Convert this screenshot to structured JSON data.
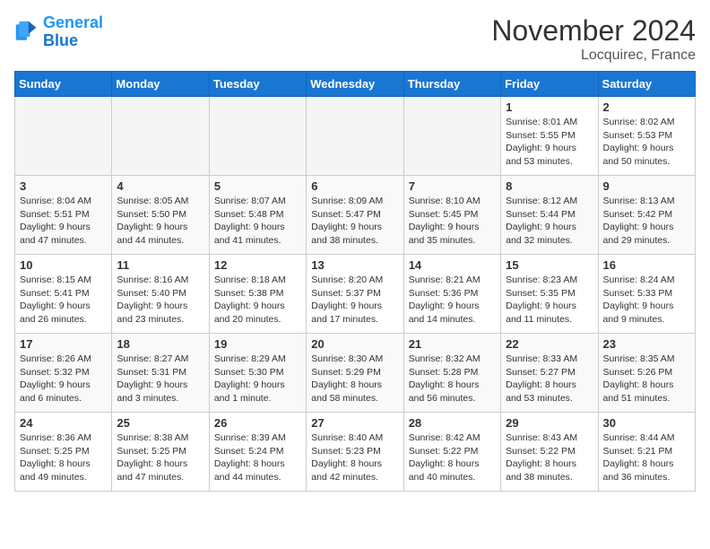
{
  "logo": {
    "line1": "General",
    "line2": "Blue"
  },
  "title": "November 2024",
  "location": "Locquirec, France",
  "weekdays": [
    "Sunday",
    "Monday",
    "Tuesday",
    "Wednesday",
    "Thursday",
    "Friday",
    "Saturday"
  ],
  "weeks": [
    [
      {
        "day": "",
        "info": ""
      },
      {
        "day": "",
        "info": ""
      },
      {
        "day": "",
        "info": ""
      },
      {
        "day": "",
        "info": ""
      },
      {
        "day": "",
        "info": ""
      },
      {
        "day": "1",
        "info": "Sunrise: 8:01 AM\nSunset: 5:55 PM\nDaylight: 9 hours and 53 minutes."
      },
      {
        "day": "2",
        "info": "Sunrise: 8:02 AM\nSunset: 5:53 PM\nDaylight: 9 hours and 50 minutes."
      }
    ],
    [
      {
        "day": "3",
        "info": "Sunrise: 8:04 AM\nSunset: 5:51 PM\nDaylight: 9 hours and 47 minutes."
      },
      {
        "day": "4",
        "info": "Sunrise: 8:05 AM\nSunset: 5:50 PM\nDaylight: 9 hours and 44 minutes."
      },
      {
        "day": "5",
        "info": "Sunrise: 8:07 AM\nSunset: 5:48 PM\nDaylight: 9 hours and 41 minutes."
      },
      {
        "day": "6",
        "info": "Sunrise: 8:09 AM\nSunset: 5:47 PM\nDaylight: 9 hours and 38 minutes."
      },
      {
        "day": "7",
        "info": "Sunrise: 8:10 AM\nSunset: 5:45 PM\nDaylight: 9 hours and 35 minutes."
      },
      {
        "day": "8",
        "info": "Sunrise: 8:12 AM\nSunset: 5:44 PM\nDaylight: 9 hours and 32 minutes."
      },
      {
        "day": "9",
        "info": "Sunrise: 8:13 AM\nSunset: 5:42 PM\nDaylight: 9 hours and 29 minutes."
      }
    ],
    [
      {
        "day": "10",
        "info": "Sunrise: 8:15 AM\nSunset: 5:41 PM\nDaylight: 9 hours and 26 minutes."
      },
      {
        "day": "11",
        "info": "Sunrise: 8:16 AM\nSunset: 5:40 PM\nDaylight: 9 hours and 23 minutes."
      },
      {
        "day": "12",
        "info": "Sunrise: 8:18 AM\nSunset: 5:38 PM\nDaylight: 9 hours and 20 minutes."
      },
      {
        "day": "13",
        "info": "Sunrise: 8:20 AM\nSunset: 5:37 PM\nDaylight: 9 hours and 17 minutes."
      },
      {
        "day": "14",
        "info": "Sunrise: 8:21 AM\nSunset: 5:36 PM\nDaylight: 9 hours and 14 minutes."
      },
      {
        "day": "15",
        "info": "Sunrise: 8:23 AM\nSunset: 5:35 PM\nDaylight: 9 hours and 11 minutes."
      },
      {
        "day": "16",
        "info": "Sunrise: 8:24 AM\nSunset: 5:33 PM\nDaylight: 9 hours and 9 minutes."
      }
    ],
    [
      {
        "day": "17",
        "info": "Sunrise: 8:26 AM\nSunset: 5:32 PM\nDaylight: 9 hours and 6 minutes."
      },
      {
        "day": "18",
        "info": "Sunrise: 8:27 AM\nSunset: 5:31 PM\nDaylight: 9 hours and 3 minutes."
      },
      {
        "day": "19",
        "info": "Sunrise: 8:29 AM\nSunset: 5:30 PM\nDaylight: 9 hours and 1 minute."
      },
      {
        "day": "20",
        "info": "Sunrise: 8:30 AM\nSunset: 5:29 PM\nDaylight: 8 hours and 58 minutes."
      },
      {
        "day": "21",
        "info": "Sunrise: 8:32 AM\nSunset: 5:28 PM\nDaylight: 8 hours and 56 minutes."
      },
      {
        "day": "22",
        "info": "Sunrise: 8:33 AM\nSunset: 5:27 PM\nDaylight: 8 hours and 53 minutes."
      },
      {
        "day": "23",
        "info": "Sunrise: 8:35 AM\nSunset: 5:26 PM\nDaylight: 8 hours and 51 minutes."
      }
    ],
    [
      {
        "day": "24",
        "info": "Sunrise: 8:36 AM\nSunset: 5:25 PM\nDaylight: 8 hours and 49 minutes."
      },
      {
        "day": "25",
        "info": "Sunrise: 8:38 AM\nSunset: 5:25 PM\nDaylight: 8 hours and 47 minutes."
      },
      {
        "day": "26",
        "info": "Sunrise: 8:39 AM\nSunset: 5:24 PM\nDaylight: 8 hours and 44 minutes."
      },
      {
        "day": "27",
        "info": "Sunrise: 8:40 AM\nSunset: 5:23 PM\nDaylight: 8 hours and 42 minutes."
      },
      {
        "day": "28",
        "info": "Sunrise: 8:42 AM\nSunset: 5:22 PM\nDaylight: 8 hours and 40 minutes."
      },
      {
        "day": "29",
        "info": "Sunrise: 8:43 AM\nSunset: 5:22 PM\nDaylight: 8 hours and 38 minutes."
      },
      {
        "day": "30",
        "info": "Sunrise: 8:44 AM\nSunset: 5:21 PM\nDaylight: 8 hours and 36 minutes."
      }
    ]
  ]
}
